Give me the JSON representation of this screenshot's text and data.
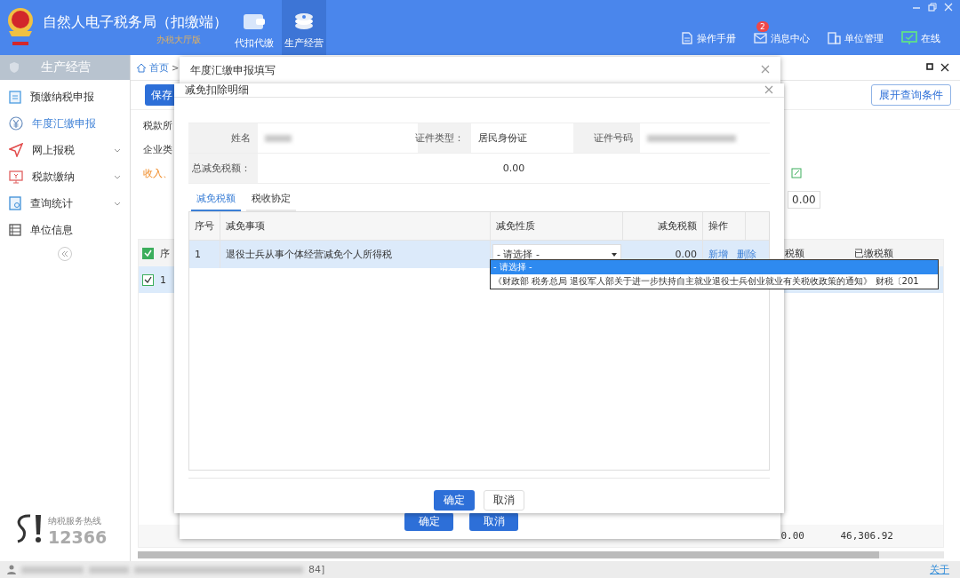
{
  "header": {
    "title": "自然人电子税务局（扣缴端）",
    "subtitle": "办税大厅版",
    "nav": [
      {
        "label": "代扣代缴",
        "kind": "wallet",
        "selected": false
      },
      {
        "label": "生产经营",
        "kind": "coins",
        "selected": true
      }
    ],
    "tools": [
      {
        "label": "操作手册",
        "kind": "manual"
      },
      {
        "label": "消息中心",
        "kind": "message",
        "badge": "2"
      },
      {
        "label": "单位管理",
        "kind": "org"
      },
      {
        "label": "在线",
        "kind": "online"
      }
    ]
  },
  "sidebar": {
    "title": "生产经营",
    "items": [
      {
        "label": "预缴纳税申报",
        "kind": "clipboard",
        "selected": false,
        "expandable": false
      },
      {
        "label": "年度汇缴申报",
        "kind": "yen",
        "selected": true,
        "expandable": false
      },
      {
        "label": "网上报税",
        "kind": "send",
        "selected": false,
        "expandable": true
      },
      {
        "label": "税款缴纳",
        "kind": "pay",
        "selected": false,
        "expandable": true
      },
      {
        "label": "查询统计",
        "kind": "report",
        "selected": false,
        "expandable": true
      },
      {
        "label": "单位信息",
        "kind": "list",
        "selected": false,
        "expandable": false
      }
    ],
    "hotline": {
      "label": "纳税服务热线",
      "number": "12366"
    }
  },
  "main": {
    "breadcrumb": {
      "home": "首页",
      "separator": ">"
    },
    "save_button": "保存",
    "expand_button": "展开查询条件",
    "form_lines": [
      {
        "text": "税款所",
        "kind": "normal"
      },
      {
        "text": "企业类",
        "kind": "normal"
      },
      {
        "text": "收入、",
        "kind": "warning"
      }
    ],
    "amount_field": "0.00",
    "table": {
      "header_checked": true,
      "columns": [
        "序",
        "税额",
        "已缴税额"
      ],
      "rows": [
        {
          "index": "1",
          "checked": true,
          "selected": true
        }
      ],
      "totals": [
        "0.00",
        "46,306.92"
      ]
    }
  },
  "outer_dialog": {
    "title": "年度汇缴申报填写",
    "buttons": [
      {
        "label": "确定",
        "kind": "primary"
      },
      {
        "label": "取消",
        "kind": "primary"
      }
    ]
  },
  "dialog": {
    "title": "减免扣除明细",
    "fields": [
      {
        "label": "姓名"
      },
      {
        "label": "证件类型：",
        "value": "居民身份证"
      },
      {
        "label": "证件号码"
      }
    ],
    "total": {
      "label": "总减免税额：",
      "value": "0.00"
    },
    "tabs": [
      {
        "label": "减免税额",
        "selected": true
      },
      {
        "label": "税收协定",
        "selected": false
      }
    ],
    "table": {
      "columns": [
        "序号",
        "减免事项",
        "减免性质",
        "减免税额",
        "操作"
      ],
      "rows": [
        {
          "index": "1",
          "item": "退役士兵从事个体经营减免个人所得税",
          "nature": "- 请选择 -",
          "amount": "0.00",
          "actions": [
            "新增",
            "删除"
          ],
          "selected": true
        }
      ]
    },
    "dropdown": {
      "options": [
        {
          "label": "- 请选择 -",
          "selected": true
        },
        {
          "label": "《财政部 税务总局 退役军人部关于进一步扶持自主就业退役士兵创业就业有关税收政策的通知》 财税〔201",
          "selected": false
        }
      ]
    },
    "buttons": [
      {
        "label": "确定",
        "kind": "primary"
      },
      {
        "label": "取消",
        "kind": "default"
      }
    ]
  },
  "status_bar": {
    "text": "84]",
    "link": "关于"
  }
}
